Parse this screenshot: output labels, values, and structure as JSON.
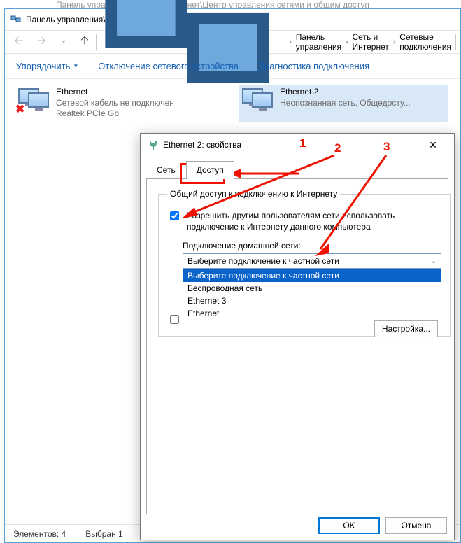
{
  "ghost_title": "Панель управления\\Сеть и Интернет\\Центр управления сетями и общим доступ",
  "window": {
    "title": "Панель управления\\Сеть и Интернет\\Сетевые подключения",
    "breadcrumbs": [
      "Панель управления",
      "Сеть и Интернет",
      "Сетевые подключения"
    ]
  },
  "toolbar": {
    "organize": "Упорядочить",
    "disable": "Отключение сетевого устройства",
    "diag": "Диагностика подключения"
  },
  "connections": [
    {
      "name": "Ethernet",
      "status": "Сетевой кабель не подключен",
      "adapter": "Realtek PCIe Gb",
      "disconnected": true
    },
    {
      "name": "Ethernet 2",
      "status": "Неопознанная сеть, Общедосту...",
      "adapter": "",
      "disconnected": false
    }
  ],
  "status": {
    "count_label": "Элементов: 4",
    "selected_label": "Выбран 1"
  },
  "dialog": {
    "title": "Ethernet 2: свойства",
    "tabs": {
      "net": "Сеть",
      "share": "Доступ"
    },
    "group_legend": "Общий доступ к подключению к Интернету",
    "allow_label": "Разрешить другим пользователям сети использовать подключение к Интернету данного компьютера",
    "home_net_label": "Подключение домашней сети:",
    "combo_value": "Выберите подключение к частной сети",
    "options": [
      "Выберите подключение к частной сети",
      "Беспроводная сеть",
      "Ethernet 3",
      "Ethernet"
    ],
    "allow_control_label": "",
    "settings_btn": "Настройка...",
    "ok": "OK",
    "cancel": "Отмена"
  },
  "annotations": {
    "n1": "1",
    "n2": "2",
    "n3": "3"
  }
}
